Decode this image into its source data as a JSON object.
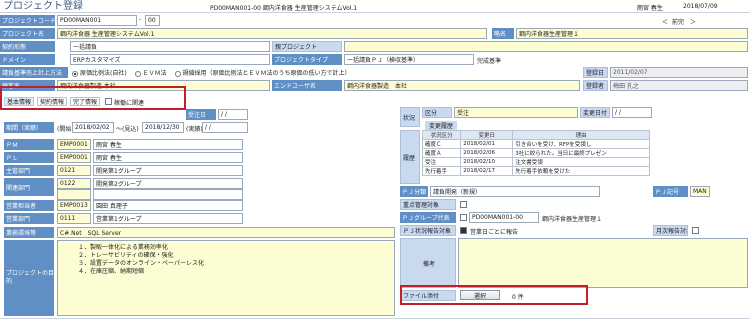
{
  "header": {
    "title": "プロジェクト登録",
    "screen": "PD00MAN001-00 鋼内洋食器 生産管理システムVol.1",
    "user": "雨宮 春生",
    "date": "2018/07/09",
    "nav_prev": "＜",
    "nav_label": "前完",
    "nav_next": "＞"
  },
  "fields": {
    "code_label": "プロジェクトコード",
    "code_value": "PD00MAN001",
    "code_suffix": "00",
    "name_label": "プロジェクト名",
    "name_value": "鋼内洋食器 生産管理システムVol.1",
    "abbr_label": "略名",
    "abbr_value": "鋼内洋食器生産管理１",
    "contract_label": "契約形態",
    "contract_value": "一括請負",
    "parent_label": "親プロジェクト",
    "domain_label": "ドメイン",
    "domain_value": "ERPカスタマイズ",
    "ptype_label": "プロジェクトタイプ",
    "ptype_value": "一括請負ＰＪ（検収基準）",
    "ptype_note": "完成基準",
    "sales_label": "請負基準売上計上方法",
    "sales_opt1": "原価比例法(自社)",
    "sales_opt2": "ＥＶＭ法",
    "sales_opt3": "規値採用（原価比例法とＥＶＭ法のうち原価の低い方で計上）",
    "reg_date_label": "登録日",
    "reg_date_value": "2011/02/07",
    "customer_label": "顧客名",
    "customer_value": "鋼内洋食器製造 本社",
    "enduser_label": "エンドユーザ名",
    "enduser_value": "鋼内洋食器製造　本社",
    "registrant_label": "登録者",
    "registrant_value": "梅田 孔之"
  },
  "tabs": [
    {
      "label": "基本情報"
    },
    {
      "label": "契約情報"
    },
    {
      "label": "完了情報"
    },
    {
      "label": "稼働に関連"
    }
  ],
  "left": {
    "due_label": "受注日",
    "due_value": "/ /",
    "period_label": "期間（実績）",
    "period_start_label": "(開始)",
    "period_start": "2018/02/02",
    "period_sep": "〜(見込)",
    "period_end": "2018/12/30",
    "period_actual": "(実績)",
    "period_actual_value": "/ /",
    "pm_label": "ＰＭ",
    "pm_code": "EMP0001",
    "pm_name": "雨宮 春生",
    "pl_label": "ＰＬ",
    "pl_code": "EMP0001",
    "pl_name": "雨宮 春生",
    "dept_label": "主管部門",
    "dept_code": "0121",
    "dept_name": "開発第1グループ",
    "rel_label": "関連部門",
    "rel_code": "0122",
    "rel_name": "開発第2グループ",
    "sales_mgr_label": "営業担当者",
    "sales_mgr_code": "EMP0013",
    "sales_mgr_name": "園田 真理子",
    "sales_dept_label": "営業部門",
    "sales_dept_code": "0111",
    "sales_dept_name": "営業第1グループ",
    "env_label": "業務環境等",
    "env_value": "C#.Net　SQL Server",
    "purpose_label": "プロジェクトの目的",
    "purpose_lines": [
      "１．製販一体化による業務効率化",
      "２．トレーサビリティの確保・強化",
      "３．設置データのオンライン・ペーパーレス化",
      "４．在庫圧縮、納期短縮"
    ]
  },
  "right": {
    "status_label": "状況",
    "kubun_label": "区分",
    "kubun_value": "受注",
    "change_date_label": "変更日付",
    "change_date_value": "/ /",
    "history_label": "履歴",
    "history_title": "変更履歴",
    "history_headers": [
      "状況区分",
      "変更日",
      "理由"
    ],
    "history_rows": [
      [
        "確度Ｃ",
        "2018/02/01",
        "引き合いを受け、RFPを受領し"
      ],
      [
        "確度Ａ",
        "2018/02/06",
        "3社に絞られた。当日に最終プレゼン"
      ],
      [
        "受注",
        "2018/02/10",
        "注文書受領"
      ],
      [
        "先行着手",
        "2018/02/17",
        "先行着手依頼を受けた"
      ]
    ],
    "pj_class_label": "ＰＪ分類",
    "pj_class_value": "請負開発（新規）",
    "pj_sign_label": "ＰＪ記号",
    "pj_sign_value": "MAN",
    "important_label": "重点管理対象",
    "group_label": "ＰＪグループ代表",
    "group_code": "PD00MAN001-00",
    "group_name": "鋼内洋食器生産管理１",
    "report_label": "ＰＪ状況報告対象",
    "report_value": "営業日ごとに報告",
    "monthly_label": "月次報告対象",
    "remarks_label": "備考",
    "file_label": "ファイル添付",
    "file_button": "選択",
    "file_count": "0 件"
  }
}
